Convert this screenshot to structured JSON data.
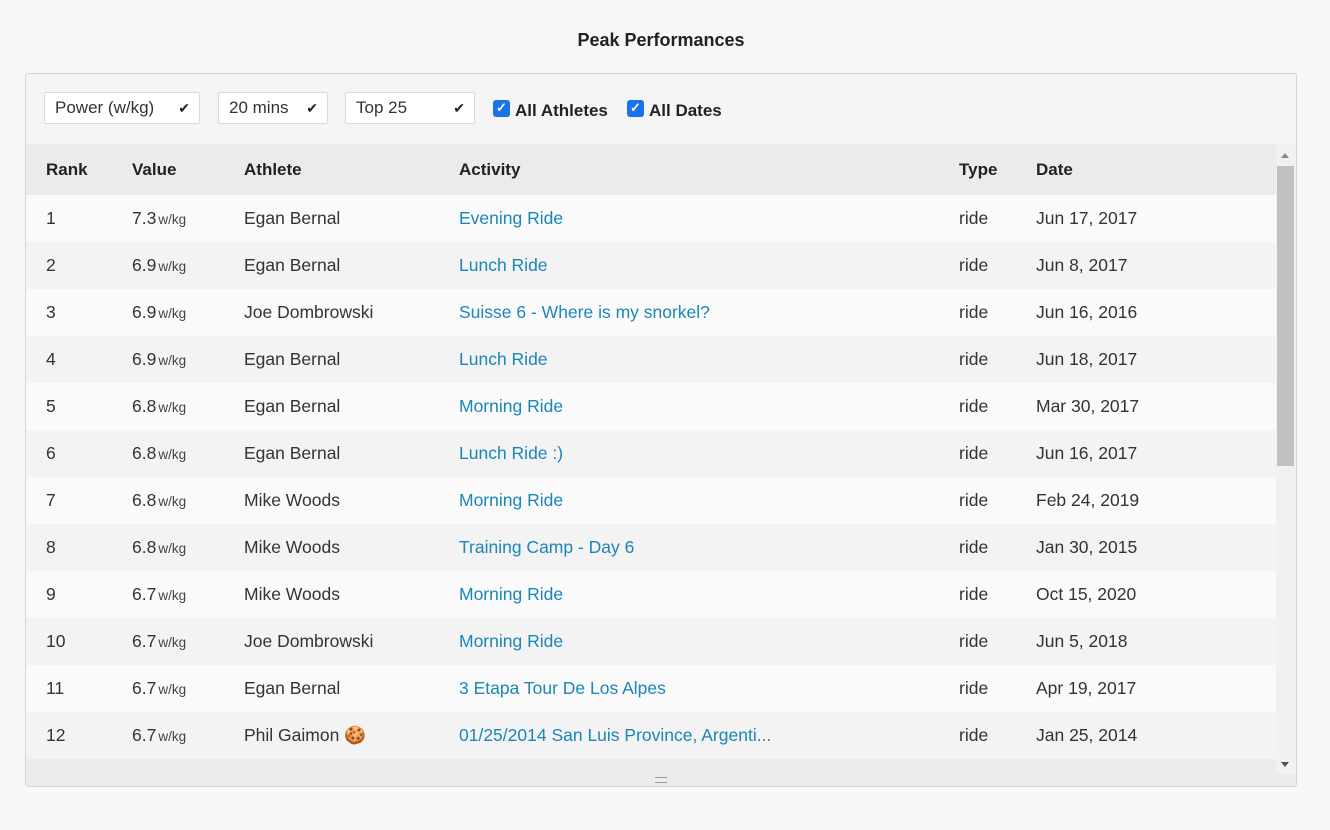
{
  "title": "Peak Performances",
  "filters": {
    "metric": "Power (w/kg)",
    "duration": "20 mins",
    "limit": "Top 25",
    "all_athletes": "All Athletes",
    "all_dates": "All Dates"
  },
  "table": {
    "columns": [
      "Rank",
      "Value",
      "Athlete",
      "Activity",
      "Type",
      "Date"
    ],
    "unit": "w/kg",
    "rows": [
      {
        "rank": "1",
        "value": "7.3",
        "athlete": "Egan Bernal",
        "activity": "Evening Ride",
        "type": "ride",
        "date": "Jun 17, 2017"
      },
      {
        "rank": "2",
        "value": "6.9",
        "athlete": "Egan Bernal",
        "activity": "Lunch Ride",
        "type": "ride",
        "date": "Jun 8, 2017"
      },
      {
        "rank": "3",
        "value": "6.9",
        "athlete": "Joe Dombrowski",
        "activity": "Suisse 6 - Where is my snorkel?",
        "type": "ride",
        "date": "Jun 16, 2016"
      },
      {
        "rank": "4",
        "value": "6.9",
        "athlete": "Egan Bernal",
        "activity": "Lunch Ride",
        "type": "ride",
        "date": "Jun 18, 2017"
      },
      {
        "rank": "5",
        "value": "6.8",
        "athlete": "Egan Bernal",
        "activity": "Morning Ride",
        "type": "ride",
        "date": "Mar 30, 2017"
      },
      {
        "rank": "6",
        "value": "6.8",
        "athlete": "Egan Bernal",
        "activity": "Lunch Ride :)",
        "type": "ride",
        "date": "Jun 16, 2017"
      },
      {
        "rank": "7",
        "value": "6.8",
        "athlete": "Mike Woods",
        "activity": "Morning Ride",
        "type": "ride",
        "date": "Feb 24, 2019"
      },
      {
        "rank": "8",
        "value": "6.8",
        "athlete": "Mike Woods",
        "activity": "Training Camp - Day 6",
        "type": "ride",
        "date": "Jan 30, 2015"
      },
      {
        "rank": "9",
        "value": "6.7",
        "athlete": "Mike Woods",
        "activity": "Morning Ride",
        "type": "ride",
        "date": "Oct 15, 2020"
      },
      {
        "rank": "10",
        "value": "6.7",
        "athlete": "Joe Dombrowski",
        "activity": "Morning Ride",
        "type": "ride",
        "date": "Jun 5, 2018"
      },
      {
        "rank": "11",
        "value": "6.7",
        "athlete": "Egan Bernal",
        "activity": "3 Etapa Tour De Los Alpes",
        "type": "ride",
        "date": "Apr 19, 2017"
      },
      {
        "rank": "12",
        "value": "6.7",
        "athlete": "Phil Gaimon 🍪",
        "activity": "01/25/2014 San Luis Province, Argenti...",
        "type": "ride",
        "date": "Jan 25, 2014"
      }
    ]
  }
}
